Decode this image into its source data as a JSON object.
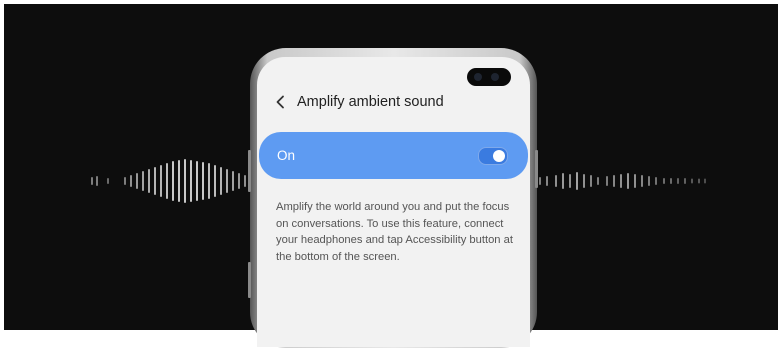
{
  "header": {
    "back_icon": "chevron-left-icon",
    "title": "Amplify ambient sound"
  },
  "toggle": {
    "label": "On",
    "state": "on",
    "accent_color": "#5e9bf2"
  },
  "description": "Amplify the world around you and put the focus on conversations. To use this feature, connect your headphones and tap Accessibility button at the bottom of the screen."
}
